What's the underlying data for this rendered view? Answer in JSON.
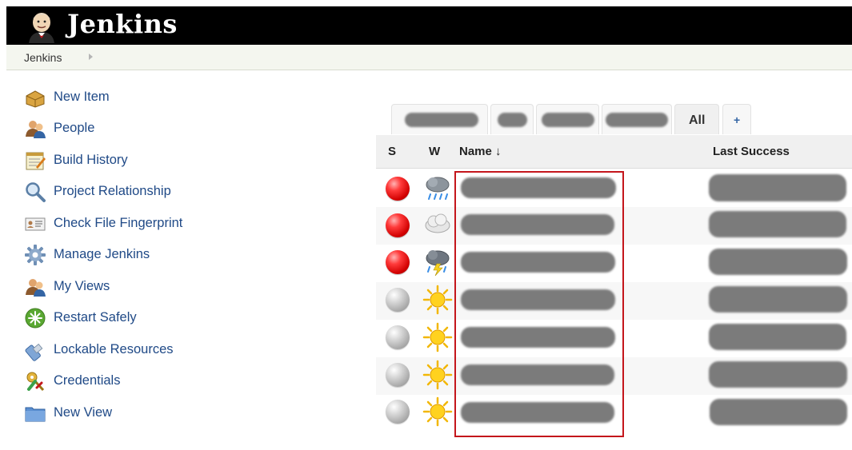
{
  "header": {
    "brand": "Jenkins",
    "logo_icon": "jenkins-butler-icon",
    "background_color": "#000000"
  },
  "breadcrumb": {
    "items": [
      "Jenkins"
    ]
  },
  "sidebar": {
    "items": [
      {
        "label": "New Item",
        "icon": "new-item-icon"
      },
      {
        "label": "People",
        "icon": "people-icon"
      },
      {
        "label": "Build History",
        "icon": "notepad-icon"
      },
      {
        "label": "Project Relationship",
        "icon": "magnifier-icon"
      },
      {
        "label": "Check File Fingerprint",
        "icon": "fingerprint-card-icon"
      },
      {
        "label": "Manage Jenkins",
        "icon": "gear-icon"
      },
      {
        "label": "My Views",
        "icon": "people-icon"
      },
      {
        "label": "Restart Safely",
        "icon": "restart-icon"
      },
      {
        "label": "Lockable Resources",
        "icon": "usb-key-icon"
      },
      {
        "label": "Credentials",
        "icon": "keys-icon"
      },
      {
        "label": "New View",
        "icon": "folder-icon"
      }
    ],
    "link_color": "#204a87"
  },
  "tabs": {
    "all_label": "All",
    "add_label": "+",
    "redacted_count": 4
  },
  "table": {
    "headers": {
      "status": "S",
      "weather": "W",
      "name": "Name ↓",
      "last_success": "Last Success"
    },
    "rows": [
      {
        "status": "red",
        "weather": "rain-cloud-icon"
      },
      {
        "status": "red",
        "weather": "cloud-icon"
      },
      {
        "status": "red",
        "weather": "thunderstorm-icon"
      },
      {
        "status": "grey",
        "weather": "sun-icon"
      },
      {
        "status": "grey",
        "weather": "sun-icon"
      },
      {
        "status": "grey",
        "weather": "sun-icon"
      },
      {
        "status": "grey",
        "weather": "sun-icon"
      }
    ],
    "highlight_color": "#c4161c"
  }
}
